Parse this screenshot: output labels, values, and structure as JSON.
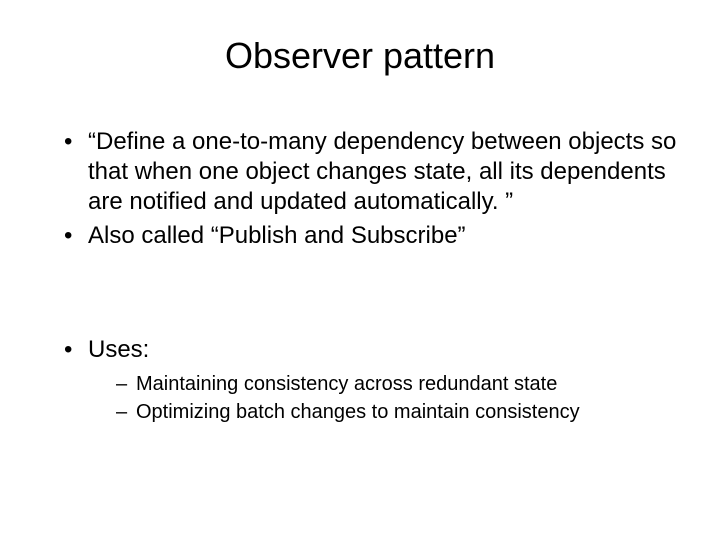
{
  "title": "Observer pattern",
  "bullets": {
    "definition": "“Define a one-to-many dependency between objects so that when one object changes state, all its dependents are notified and updated automatically. ”",
    "aka": "Also called “Publish and Subscribe”",
    "uses_label": "Uses:",
    "uses": {
      "item1": "Maintaining consistency across redundant state",
      "item2": "Optimizing batch changes to maintain consistency"
    }
  }
}
